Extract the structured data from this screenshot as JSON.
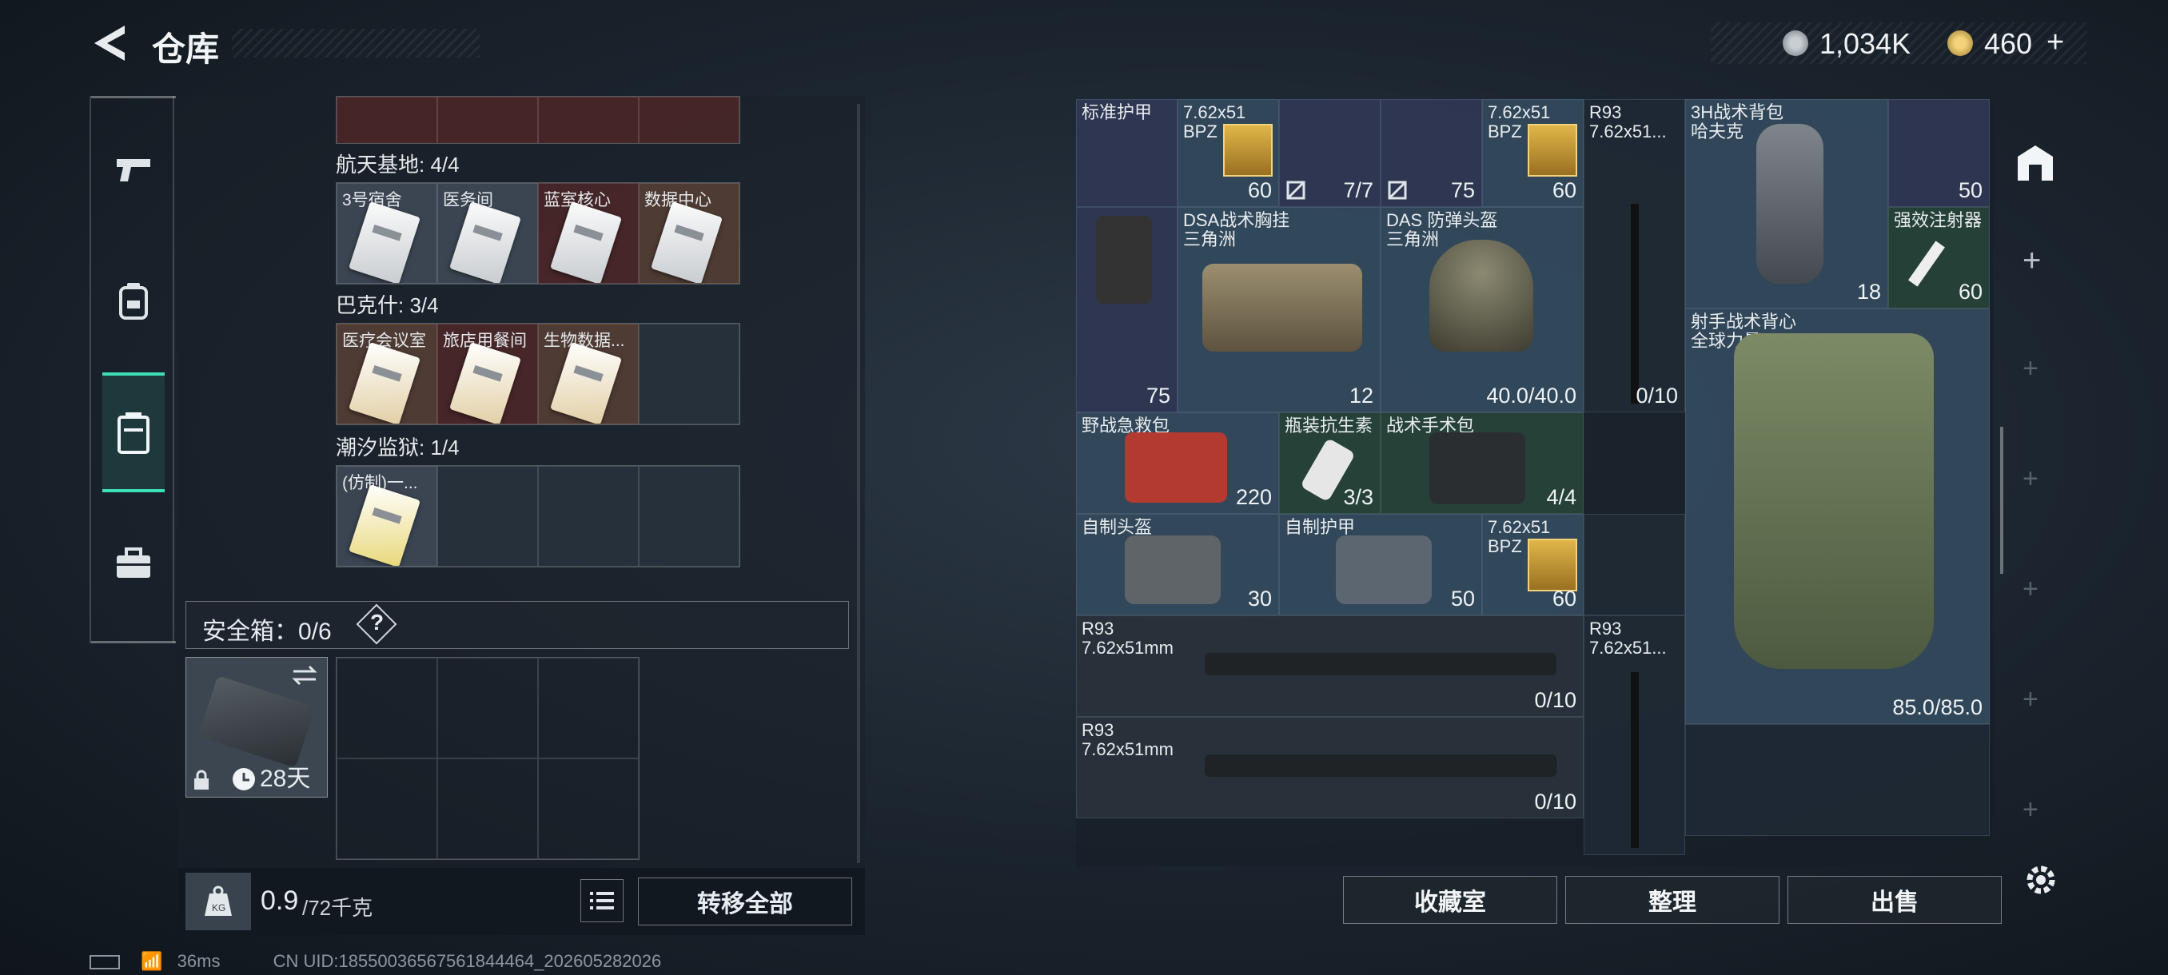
{
  "header": {
    "title": "仓库",
    "currency1": "1,034K",
    "currency2": "460",
    "plus": "+"
  },
  "sidebar": {
    "items": [
      "weapon",
      "backpack",
      "storage",
      "toolbox"
    ]
  },
  "left": {
    "top_row_hint": "",
    "sections": [
      {
        "title": "航天基地: 4/4",
        "cells": [
          "3号宿舍",
          "医务间",
          "蓝室核心",
          "数据中心"
        ]
      },
      {
        "title": "巴克什: 3/4",
        "cells": [
          "医疗会议室",
          "旅店用餐间",
          "生物数据...",
          ""
        ]
      },
      {
        "title": "潮汐监狱: 1/4",
        "cells": [
          "(仿制)一...",
          "",
          "",
          ""
        ]
      }
    ],
    "safebox": {
      "label": "安全箱：0/6",
      "help": "?",
      "days": "28天"
    },
    "weight": {
      "value": "0.9",
      "max": "/72千克"
    },
    "transfer_all": "转移全部"
  },
  "right": {
    "items": {
      "armor_std": "标准护甲",
      "ammo1_name": "7.62x51\nBPZ",
      "ammo1_val": "60",
      "slot3_val": "7/7",
      "slot4_val": "75",
      "ammo2_name": "7.62x51\nBPZ",
      "ammo2_val": "60",
      "r93_top": "R93\n7.62x51...",
      "backpack": "3H战术背包\n哈夫克",
      "slot9_val": "50",
      "dsa_chest": "DSA战术胸挂\n三角洲",
      "dsa_val": "12",
      "gadget_val": "75",
      "das_helmet": "DAS 防弹头盔\n三角洲",
      "das_val": "40.0/40.0",
      "backpack_val": "18",
      "injector": "强效注射器",
      "injector_val": "60",
      "sniper_vest": "射手战术背心\n全球力量",
      "vest_val": "85.0/85.0",
      "firstaid": "野战急救包",
      "firstaid_val": "220",
      "antibiotic": "瓶装抗生素",
      "antibiotic_val": "3/3",
      "surgery": "战术手术包",
      "surgery_val": "4/4",
      "diy_helmet": "自制头盔",
      "diy_helmet_val": "30",
      "diy_armor": "自制护甲",
      "diy_armor_val": "50",
      "ammo3_name": "7.62x51\nBPZ",
      "ammo3_val": "60",
      "mag_val": "0/10",
      "r93_a": "R93\n7.62x51mm",
      "r93_a_val": "0/10",
      "r93_b": "R93\n7.62x51...",
      "r93_c": "R93\n7.62x51mm",
      "r93_c_val": "0/10"
    },
    "buttons": {
      "collect": "收藏室",
      "sort": "整理",
      "sell": "出售"
    }
  },
  "status": {
    "ping": "36ms",
    "uid": "CN UID:18550036567561844464_202605282026"
  }
}
